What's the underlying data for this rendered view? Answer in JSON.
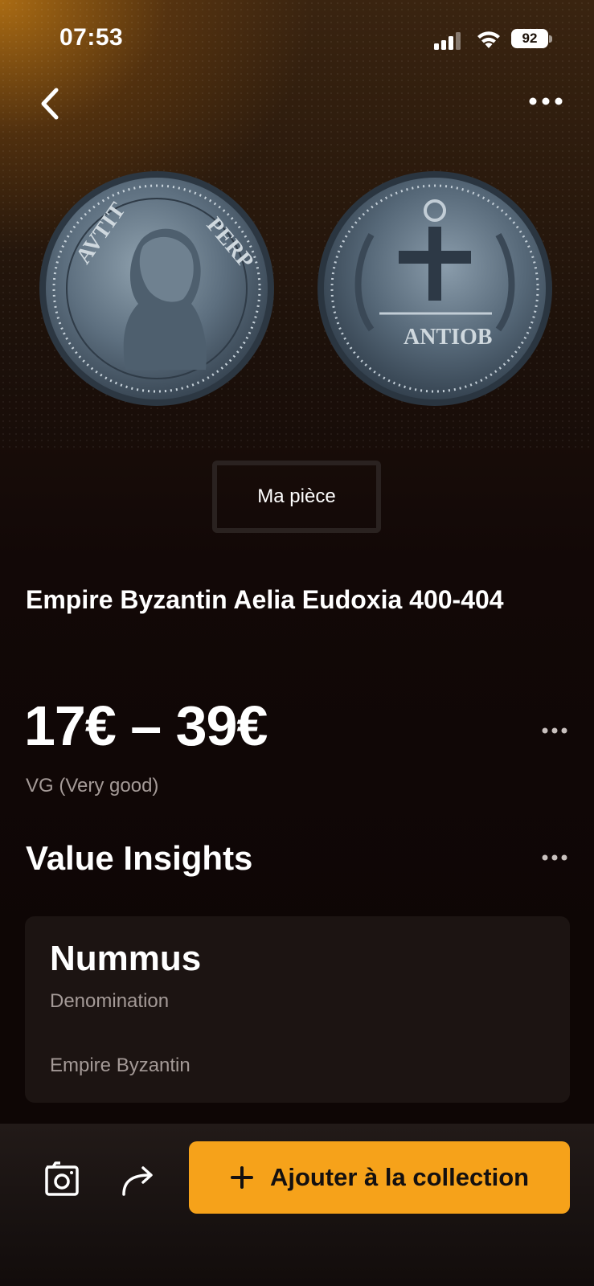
{
  "status_bar": {
    "time": "07:53",
    "battery": "92"
  },
  "nav": {
    "back_icon": "chevron-left-icon",
    "more_icon": "more-horizontal-icon"
  },
  "images": {
    "obverse": "coin-obverse-image",
    "reverse": "coin-reverse-image"
  },
  "my_coin_button": "Ma pièce",
  "coin": {
    "title": "Empire Byzantin Aelia Eudoxia 400-404",
    "price_range": "17€ – 39€",
    "grade": "VG (Very good)"
  },
  "value_insights": {
    "heading": "Value Insights",
    "denomination_value": "Nummus",
    "denomination_label": "Denomination",
    "issuer": "Empire Byzantin"
  },
  "bottom_bar": {
    "photo_icon": "camera-icon",
    "share_icon": "share-icon",
    "add_label": "Ajouter à la collection"
  },
  "colors": {
    "accent": "#f6a21a",
    "background": "#0f0706",
    "card": "#1c1412",
    "muted_text": "#a49a97"
  }
}
